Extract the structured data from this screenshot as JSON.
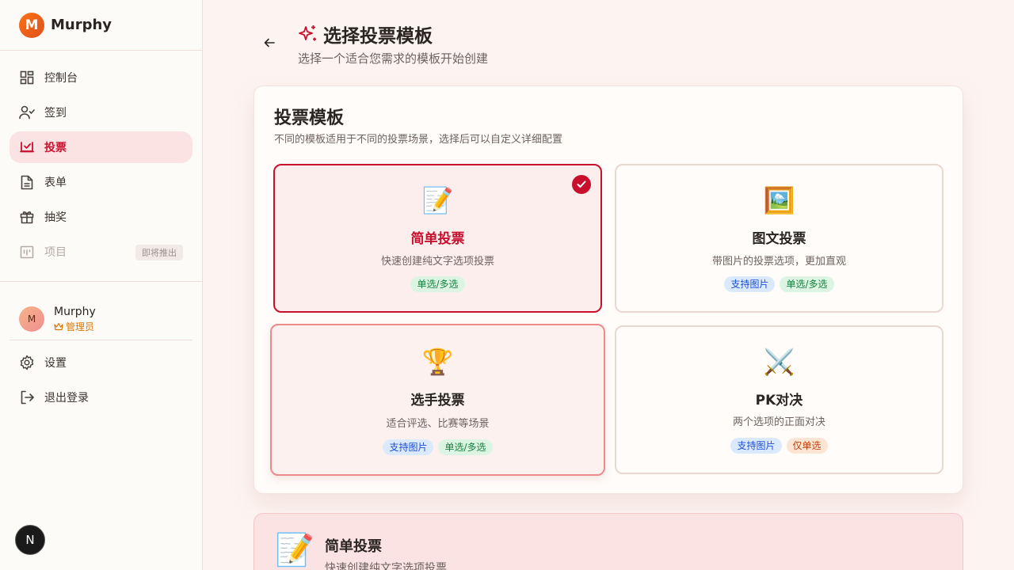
{
  "brand": {
    "logo_letter": "M",
    "name": "Murphy"
  },
  "sidebar": {
    "items": [
      {
        "label": "控制台",
        "icon": "dashboard-icon"
      },
      {
        "label": "签到",
        "icon": "user-check-icon"
      },
      {
        "label": "投票",
        "icon": "vote-icon"
      },
      {
        "label": "表单",
        "icon": "document-icon"
      },
      {
        "label": "抽奖",
        "icon": "gift-icon"
      },
      {
        "label": "项目",
        "icon": "project-icon",
        "badge": "即将推出"
      }
    ],
    "active_item": "投票",
    "user": {
      "avatar_letter": "M",
      "name": "Murphy",
      "role": "管理员"
    },
    "bottom": [
      {
        "label": "设置",
        "icon": "gear-icon"
      },
      {
        "label": "退出登录",
        "icon": "logout-icon"
      }
    ]
  },
  "next_badge": "N",
  "header": {
    "title": "选择投票模板",
    "subtitle": "选择一个适合您需求的模板开始创建"
  },
  "card": {
    "title": "投票模板",
    "description": "不同的模板适用于不同的投票场景，选择后可以自定义详细配置"
  },
  "templates": [
    {
      "emoji": "📝",
      "name": "简单投票",
      "desc": "快速创建纯文字选项投票",
      "tags": [
        "单选/多选"
      ],
      "selected": true
    },
    {
      "emoji": "🖼️",
      "name": "图文投票",
      "desc": "带图片的投票选项，更加直观",
      "tags": [
        "支持图片",
        "单选/多选"
      ]
    },
    {
      "emoji": "🏆",
      "name": "选手投票",
      "desc": "适合评选、比赛等场景",
      "tags": [
        "支持图片",
        "单选/多选"
      ]
    },
    {
      "emoji": "⚔️",
      "name": "PK对决",
      "desc": "两个选项的正面对决",
      "tags": [
        "支持图片",
        "仅单选"
      ]
    }
  ],
  "preview": {
    "emoji": "📝",
    "name": "简单投票",
    "desc": "快速创建纯文字选项投票"
  },
  "colors": {
    "accent": "#c8102e",
    "background": "#fdf4f1"
  }
}
